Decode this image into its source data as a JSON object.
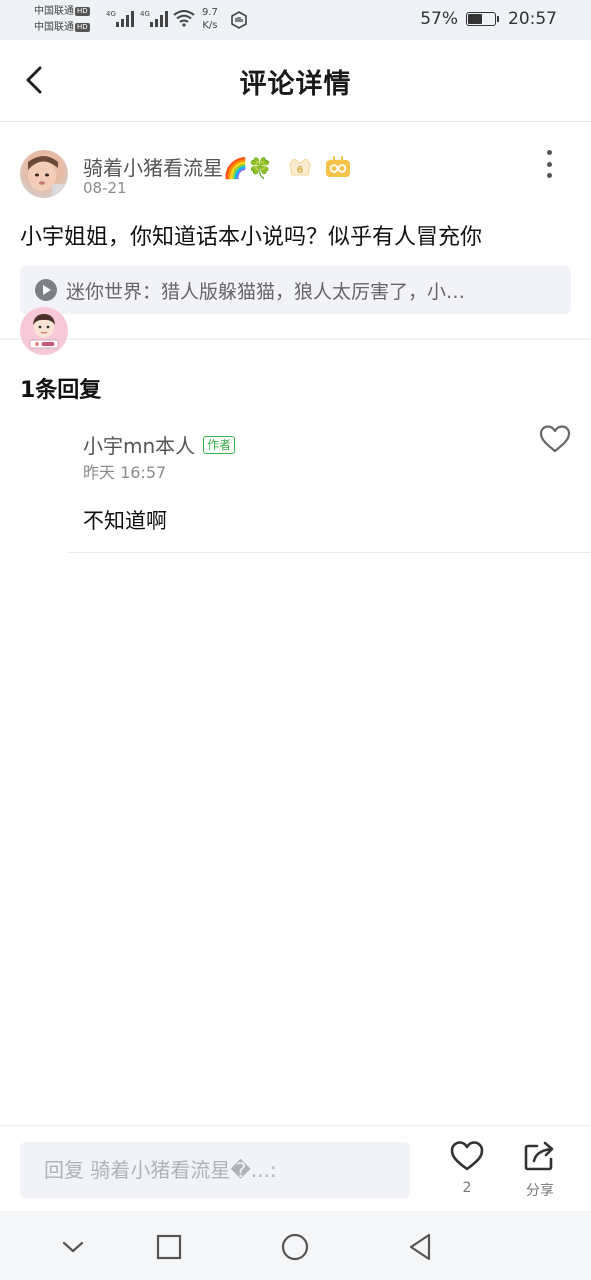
{
  "status_bar": {
    "carrier1": "中国联通",
    "carrier2": "中国联通",
    "hd": "HD",
    "net1": "4G",
    "net2": "4G",
    "speed_value": "9.7",
    "speed_unit": "K/s",
    "battery": "57%",
    "battery_level": 0.57,
    "time": "20:57"
  },
  "header": {
    "title": "评论详情",
    "back_icon": "back-chevron-icon"
  },
  "comment": {
    "username": "骑着小猪看流星🌈🍀",
    "date": "08-21",
    "text": "小宇姐姐，你知道话本小说吗？似乎有人冒充你",
    "source": "迷你世界：猎人版躲猫猫，狼人太厉害了，小…",
    "level_badge": "6",
    "icons": [
      "rainbow-icon",
      "clover-icon",
      "level-badge-icon",
      "vip-badge-icon",
      "more-icon",
      "play-icon"
    ]
  },
  "replies": {
    "count_label": "1条回复",
    "items": [
      {
        "username": "小宇mn本人",
        "tag": "作者",
        "time": "昨天 16:57",
        "text": "不知道啊"
      }
    ]
  },
  "bottom_bar": {
    "input_placeholder": "回复 骑着小猪看流星�...:",
    "like_count": "2",
    "share_label": "分享"
  },
  "nav_bar": {
    "icons": [
      "nav-collapse-icon",
      "nav-recent-icon",
      "nav-home-icon",
      "nav-back-icon"
    ]
  },
  "colors": {
    "accent_green": "#3cae4a",
    "gold": "#f5c24a",
    "input_bg": "#f1f3f8"
  }
}
